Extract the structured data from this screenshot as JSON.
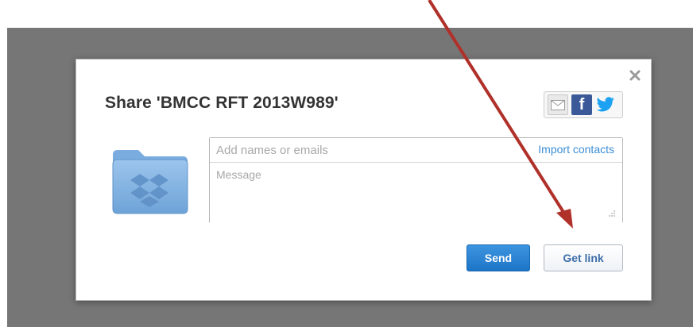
{
  "dialog": {
    "title": "Share 'BMCC RFT 2013W989'",
    "names_placeholder": "Add names or emails",
    "import_contacts_label": "Import contacts",
    "message_placeholder": "Message",
    "send_label": "Send",
    "get_link_label": "Get link"
  },
  "social": {
    "icons": [
      "email-icon",
      "facebook-icon",
      "twitter-icon"
    ],
    "facebook_glyph": "f"
  },
  "colors": {
    "accent_blue": "#1d75c7",
    "link_blue": "#3d8fd6",
    "overlay": "#767676",
    "arrow": "#b0302a",
    "facebook": "#3b5998",
    "twitter": "#1da1f2",
    "folder": "#7fb0e0"
  }
}
